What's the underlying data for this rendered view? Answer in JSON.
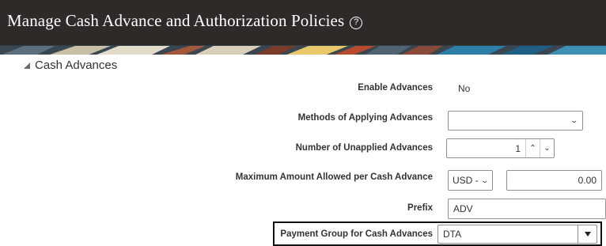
{
  "header": {
    "title": "Manage Cash Advance and Authorization Policies",
    "help_symbol": "?"
  },
  "section": {
    "title": "Cash Advances",
    "expanded": true
  },
  "fields": {
    "enable_advances": {
      "label": "Enable Advances",
      "value": "No"
    },
    "methods_applying": {
      "label": "Methods of Applying Advances",
      "value": ""
    },
    "unapplied_advances": {
      "label": "Number of Unapplied Advances",
      "value": "1"
    },
    "max_amount": {
      "label": "Maximum Amount Allowed per Cash Advance",
      "currency": "USD -",
      "amount": "0.00"
    },
    "prefix": {
      "label": "Prefix",
      "value": "ADV"
    },
    "payment_group": {
      "label": "Payment Group for Cash Advances",
      "value": "DTA"
    }
  },
  "colors": {
    "header_bg": "#2e2a28",
    "text": "#333333",
    "highlight_border": "#111111"
  }
}
